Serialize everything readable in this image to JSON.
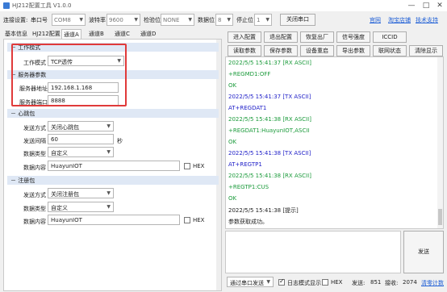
{
  "window": {
    "title": "HJ212配置工具 V1.0.0"
  },
  "toolbar": {
    "connect_label": "连接设置:",
    "port_label": "串口号",
    "port_value": "COM8",
    "baud_label": "波特率",
    "baud_value": "9600",
    "parity_label": "检验位",
    "parity_value": "NONE",
    "databits_label": "数据位",
    "databits_value": "8",
    "stopbits_label": "停止位",
    "stopbits_value": "1",
    "close_port_label": "关闭串口",
    "links": [
      "官网",
      "淘宝店铺",
      "技术支持"
    ]
  },
  "tabs": [
    "基本信息",
    "HJ212配置",
    "通道A",
    "通道B",
    "通道C",
    "通道D"
  ],
  "active_tab": "通道A",
  "work_mode": {
    "section": "工作模式",
    "label": "工作模式",
    "value": "TCP透传"
  },
  "server": {
    "section": "服务器参数",
    "address_label": "服务器地址",
    "address_value": "192.168.1.168",
    "port_label": "服务器端口",
    "port_value": "8888"
  },
  "heartbeat": {
    "section": "心跳包",
    "send_mode_label": "发送方式",
    "send_mode_value": "关闭心跳包",
    "interval_label": "发送间隔",
    "interval_value": "60",
    "interval_unit": "秒",
    "data_type_label": "数据类型",
    "data_type_value": "自定义",
    "content_label": "数据内容",
    "content_value": "HuayunIOT",
    "hex_label": "HEX"
  },
  "register": {
    "section": "注册包",
    "send_mode_label": "发送方式",
    "send_mode_value": "关闭注册包",
    "data_type_label": "数据类型",
    "data_type_value": "自定义",
    "content_label": "数据内容",
    "content_value": "HuayunIOT",
    "hex_label": "HEX"
  },
  "commands": {
    "row1": [
      "进入配置",
      "退出配置",
      "恢复出厂",
      "信号强度",
      "ICCID"
    ],
    "row2": [
      "读取参数",
      "保存参数",
      "设备重启",
      "导出参数",
      "联网状态",
      "清除显示"
    ]
  },
  "log": [
    {
      "type": "rx",
      "text": "2022/5/5 15:41:37 [RX ASCII]"
    },
    {
      "type": "rx",
      "text": "+REGMD1:OFF"
    },
    {
      "type": "rx",
      "text": "OK"
    },
    {
      "type": "tx",
      "text": "2022/5/5 15:41:37 [TX ASCII]"
    },
    {
      "type": "tx",
      "text": "AT+REGDAT1"
    },
    {
      "type": "rx",
      "text": "2022/5/5 15:41:38 [RX ASCII]"
    },
    {
      "type": "rx",
      "text": "+REGDAT1:HuayunIOT,ASCII"
    },
    {
      "type": "rx",
      "text": "OK"
    },
    {
      "type": "tx",
      "text": "2022/5/5 15:41:38 [TX ASCII]"
    },
    {
      "type": "tx",
      "text": "AT+REGTP1"
    },
    {
      "type": "rx",
      "text": "2022/5/5 15:41:38 [RX ASCII]"
    },
    {
      "type": "rx",
      "text": "+REGTP1:CUS"
    },
    {
      "type": "rx",
      "text": "OK"
    },
    {
      "type": "info",
      "text": "2022/5/5 15:41:38 [提示]"
    },
    {
      "type": "info",
      "text": "参数获取成功。"
    }
  ],
  "send": {
    "button_label": "发送",
    "mode_value": "通过串口发送",
    "log_mode_label": "日志模式显示",
    "hex_label": "HEX",
    "sent_label": "发送:",
    "sent_value": "851",
    "recv_label": "接收:",
    "recv_value": "2074",
    "clear_count_label": "清零计数"
  },
  "colors": {
    "highlight": "#e03a3a",
    "link": "#1f5fd6",
    "rx": "#1a9a3a",
    "tx": "#2020c8"
  }
}
